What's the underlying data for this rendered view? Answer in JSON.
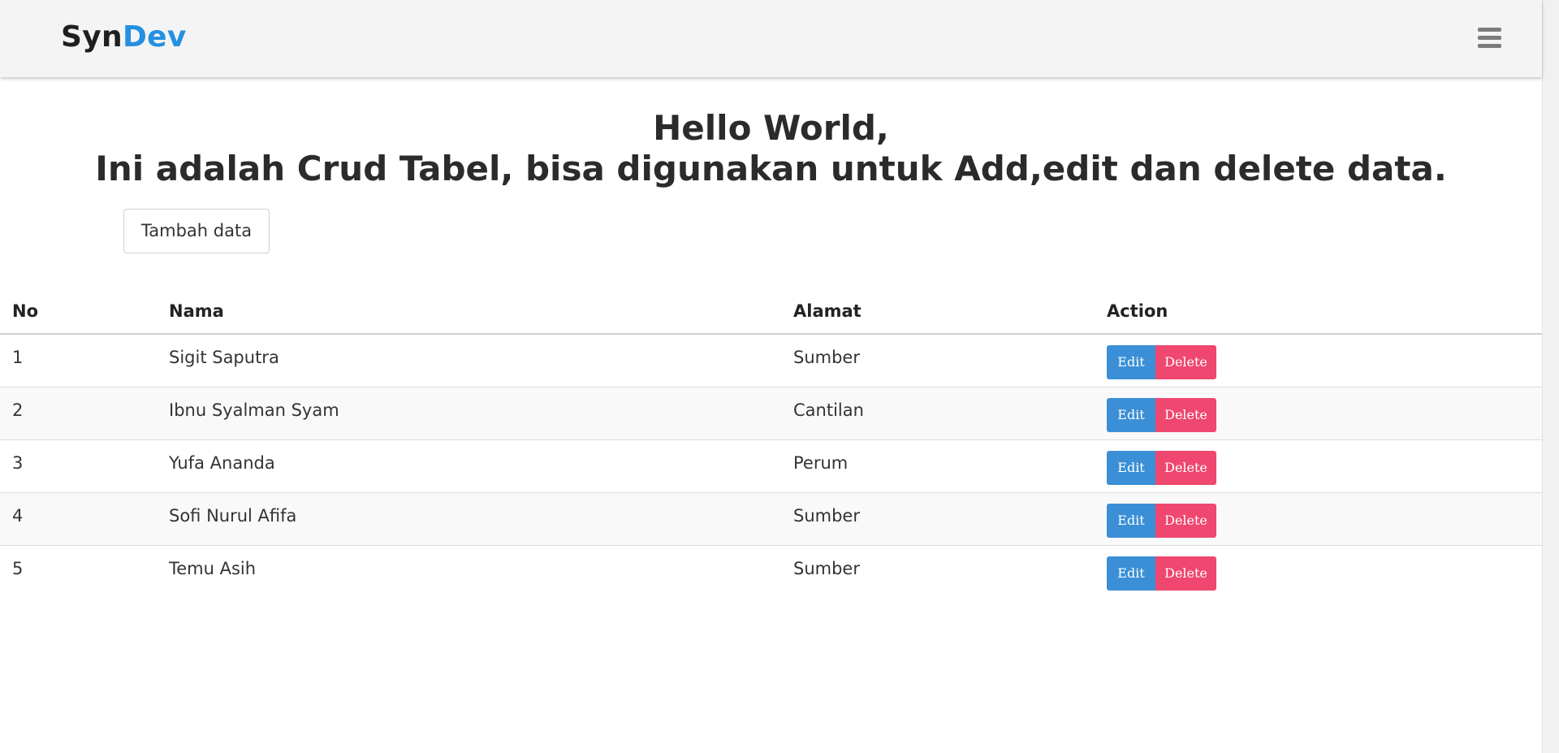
{
  "navbar": {
    "brand_part1": "Syn",
    "brand_part2": "Dev",
    "brand_colors": {
      "part1": "#1f1f1f",
      "part2": "#2490e2"
    },
    "menu_icon": "hamburger-icon"
  },
  "heading": {
    "line1": "Hello World,",
    "line2": "Ini adalah Crud Tabel, bisa digunakan untuk Add,edit dan delete data."
  },
  "add_button_label": "Tambah data",
  "table": {
    "headers": [
      "No",
      "Nama",
      "Alamat",
      "Action"
    ],
    "rows": [
      {
        "no": "1",
        "nama": "Sigit Saputra",
        "alamat": "Sumber"
      },
      {
        "no": "2",
        "nama": "Ibnu Syalman Syam",
        "alamat": "Cantilan"
      },
      {
        "no": "3",
        "nama": "Yufa Ananda",
        "alamat": "Perum"
      },
      {
        "no": "4",
        "nama": "Sofi Nurul Afifa",
        "alamat": "Sumber"
      },
      {
        "no": "5",
        "nama": "Temu Asih",
        "alamat": "Sumber"
      }
    ],
    "edit_label": "Edit",
    "delete_label": "Delete",
    "colors": {
      "edit": "#3b8fd6",
      "delete": "#ef476f"
    }
  }
}
